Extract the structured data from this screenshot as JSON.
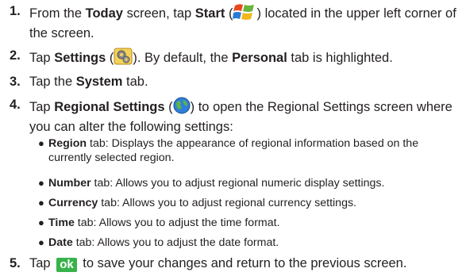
{
  "steps": [
    {
      "num": "1.",
      "a": "From the ",
      "b1": "Today",
      "c": " screen, tap ",
      "b2": "Start",
      "d": " (",
      "e": ") located in the upper left corner of",
      "f": "the screen."
    },
    {
      "num": "2.",
      "a": "Tap ",
      "b1": "Settings",
      "c": " (",
      "d": "). By default, the ",
      "b2": "Personal",
      "e": " tab is highlighted."
    },
    {
      "num": "3.",
      "a": "Tap the ",
      "b1": "System",
      "c": " tab."
    },
    {
      "num": "4.",
      "a": "Tap ",
      "b1": "Regional Settings",
      "c": " (",
      "d": ") to open the Regional Settings screen where",
      "e": "you can alter the following settings:"
    },
    {
      "num": "5.",
      "a": "Tap ",
      "ok": "ok",
      "b": " to save your changes and return to the previous screen."
    }
  ],
  "bullets": [
    {
      "label": "Region",
      "text": " tab: Displays the appearance of regional information based on the",
      "cont": "currently selected region."
    },
    {
      "label": "Number",
      "text": " tab: Allows you to adjust regional numeric display settings."
    },
    {
      "label": "Currency",
      "text": " tab: Allows you to adjust regional currency settings."
    },
    {
      "label": "Time",
      "text": " tab: Allows you to adjust the time format."
    },
    {
      "label": "Date",
      "text": " tab: Allows you to adjust the date format."
    }
  ],
  "icons": {
    "start": "windows-start-icon",
    "settings": "settings-gear-icon",
    "regional": "globe-icon"
  },
  "colors": {
    "ok_button": "#38b24a",
    "text": "#231f20"
  }
}
